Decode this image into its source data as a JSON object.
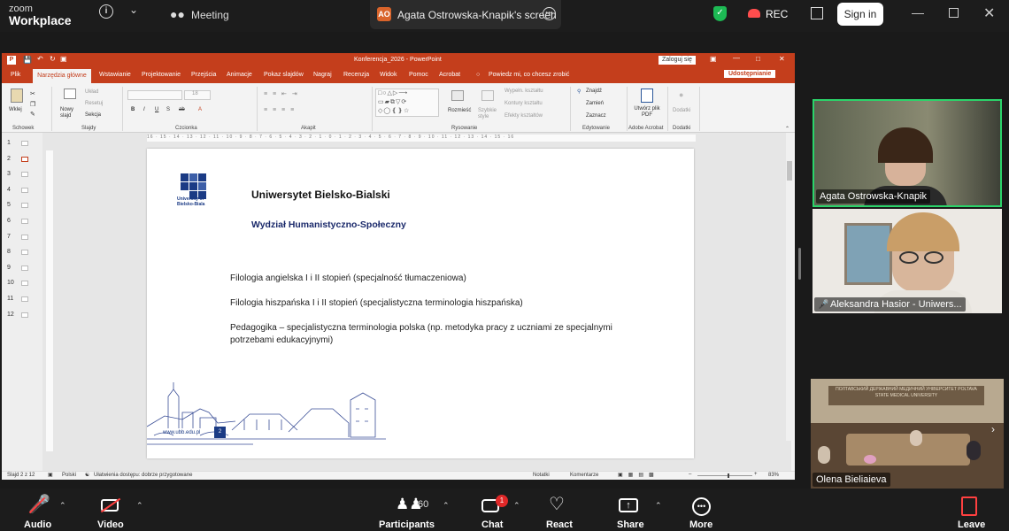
{
  "app": {
    "name_line1": "zoom",
    "name_line2": "Workplace",
    "meeting_label": "Meeting"
  },
  "share": {
    "avatar_initials": "AO",
    "label": "Agata Ostrowska-Knapik's screen"
  },
  "topbar": {
    "rec_label": "REC",
    "signin_label": "Sign in"
  },
  "ppt": {
    "title": "Konferencja_2026  -  PowerPoint",
    "login_label": "Zaloguj się",
    "share_label": "Udostępnianie",
    "tabs": [
      "Plik",
      "Narzędzia główne",
      "Wstawianie",
      "Projektowanie",
      "Przejścia",
      "Animacje",
      "Pokaz slajdów",
      "Nagraj",
      "Recenzja",
      "Widok",
      "Pomoc",
      "Acrobat",
      "Powiedz mi, co chcesz zrobić"
    ],
    "ribbon_groups": [
      "Schowek",
      "Slajdy",
      "Czcionka",
      "Akapit",
      "Rysowanie",
      "Edytowanie",
      "Adobe Acrobat",
      "Dodatki"
    ],
    "ribbon_items": {
      "paste": "Wklej",
      "new_slide": "Nowy slajd",
      "layout": "Układ",
      "reset": "Resetuj",
      "section": "Sekcja",
      "arrange": "Rozmieść",
      "quick_styles": "Szybkie style",
      "fill": "Wypełn. kształtu",
      "outline": "Kontury kształtu",
      "effects": "Efekty kształtów",
      "find": "Znajdź",
      "replace": "Zamień",
      "select": "Zaznacz",
      "create_pdf": "Utwórz plik PDF",
      "addins": "Dodatki",
      "font_size": "18"
    },
    "thumb_numbers": [
      "1",
      "2",
      "3",
      "4",
      "5",
      "6",
      "7",
      "8",
      "9",
      "10",
      "11",
      "12"
    ],
    "ruler_text": "16 · 15 · 14 · 13 · 12 · 11 · 10 · 9 · 8 · 7 · 6 · 5 · 4 · 3 · 2 · 1 · 0 · 1 · 2 · 3 · 4 · 5 · 6 · 7 · 8 · 9 · 10 · 11 · 12 · 13 · 14 · 15 · 16",
    "status": {
      "slide": "Slajd 2 z 12",
      "lang": "Polski",
      "accessibility": "Ułatwienia dostępu: dobrze przygotowane",
      "notes": "Notatki",
      "comments": "Komentarze",
      "zoom": "83%"
    }
  },
  "slide": {
    "logo_text": "University of Bielsko-Biala",
    "university": "Uniwersytet Bielsko-Bialski",
    "faculty": "Wydział Humanistyczno-Społeczny",
    "courses": [
      "Filologia angielska I i II stopień (specjalność tłumaczeniowa)",
      "Filologia hiszpańska I i II stopień (specjalistyczna terminologia hiszpańska)",
      "Pedagogika – specjalistyczna terminologia polska (np. metodyka pracy z uczniami ze specjalnymi potrzebami edukacyjnymi)"
    ],
    "url": "www.ubb.edu.pl",
    "page": "2"
  },
  "participants": [
    {
      "name": "Agata Ostrowska-Knapik"
    },
    {
      "name": "Aleksandra Hasior - Uniwers..."
    },
    {
      "name": "Olena Bieliaieva"
    }
  ],
  "room_sign": "ПОЛТАВСЬКИЙ ДЕРЖАВНИЙ МЕДИЧНИЙ УНІВЕРСИТЕТ POLTAVA STATE MEDICAL UNIVERSITY",
  "toolbar": {
    "audio": "Audio",
    "video": "Video",
    "participants": "Participants",
    "participants_count": "60",
    "chat": "Chat",
    "chat_badge": "1",
    "react": "React",
    "share": "Share",
    "more": "More",
    "leave": "Leave"
  }
}
